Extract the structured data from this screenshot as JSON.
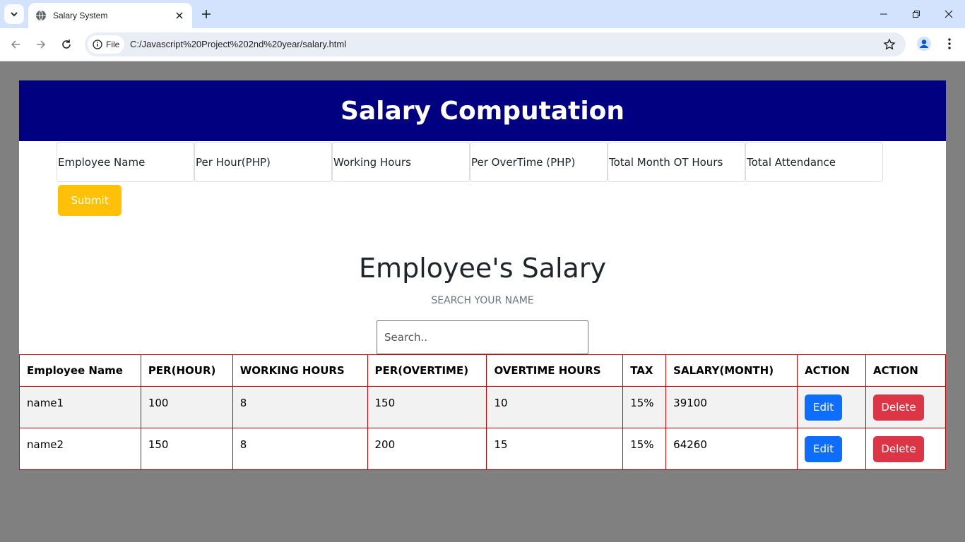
{
  "browser": {
    "tab_title": "Salary System",
    "file_label": "File",
    "url": "C:/Javascript%20Project%202nd%20year/salary.html"
  },
  "page": {
    "header_title": "Salary Computation",
    "inputs": {
      "employee_name": "Employee Name",
      "per_hour": "Per Hour(PHP)",
      "working_hours": "Working Hours",
      "per_overtime": "Per OverTime (PHP)",
      "total_month_ot": "Total Month OT Hours",
      "total_attendance": "Total Attendance"
    },
    "submit_label": "Submit",
    "section_title": "Employee's Salary",
    "section_subtitle": "SEARCH YOUR NAME",
    "search_placeholder": "Search.."
  },
  "table": {
    "headers": [
      "Employee Name",
      "PER(HOUR)",
      "WORKING HOURS",
      "PER(OVERTIME)",
      "OVERTIME HOURS",
      "TAX",
      "SALARY(MONTH)",
      "ACTION",
      "ACTION"
    ],
    "rows": [
      {
        "name": "name1",
        "per_hour": "100",
        "working_hours": "8",
        "per_overtime": "150",
        "overtime_hours": "10",
        "tax": "15%",
        "salary": "39100",
        "edit": "Edit",
        "delete": "Delete"
      },
      {
        "name": "name2",
        "per_hour": "150",
        "working_hours": "8",
        "per_overtime": "200",
        "overtime_hours": "15",
        "tax": "15%",
        "salary": "64260",
        "edit": "Edit",
        "delete": "Delete"
      }
    ]
  },
  "colors": {
    "header_bg": "#000080",
    "submit_bg": "#ffc107",
    "edit_bg": "#0d6efd",
    "delete_bg": "#dc3545",
    "table_border": "#cc0000"
  },
  "icons": [
    "chevron-down-icon",
    "globe-icon",
    "close-icon",
    "plus-icon",
    "minimize-icon",
    "restore-icon",
    "back-icon",
    "forward-icon",
    "reload-icon",
    "info-icon",
    "star-icon",
    "profile-icon",
    "more-icon"
  ]
}
